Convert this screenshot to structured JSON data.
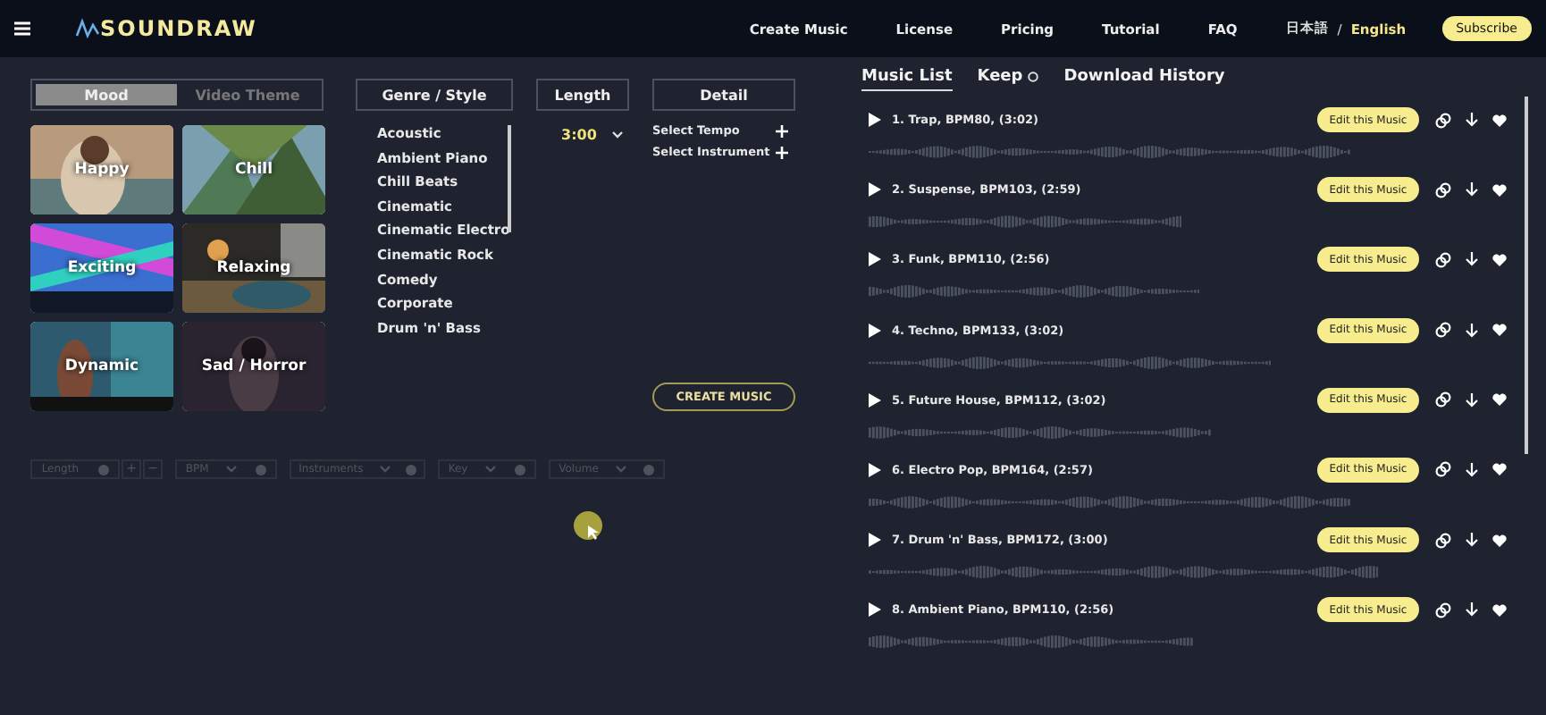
{
  "header": {
    "logo": "SOUNDRAW",
    "nav": [
      "Create Music",
      "License",
      "Pricing",
      "Tutorial",
      "FAQ"
    ],
    "languages": [
      {
        "label": "日本語",
        "selected": false
      },
      {
        "label": "English",
        "selected": true
      }
    ],
    "separator": "/",
    "subscribe": "Subscribe"
  },
  "mood_tabs": [
    {
      "label": "Mood",
      "selected": true
    },
    {
      "label": "Video Theme",
      "selected": false
    }
  ],
  "moods": [
    {
      "label": "Happy"
    },
    {
      "label": "Chill"
    },
    {
      "label": "Exciting"
    },
    {
      "label": "Relaxing"
    },
    {
      "label": "Dynamic"
    },
    {
      "label": "Sad / Horror"
    }
  ],
  "genre": {
    "title": "Genre / Style",
    "items": [
      "Acoustic",
      "Ambient Piano",
      "Chill Beats",
      "Cinematic",
      "Cinematic Electro",
      "Cinematic Rock",
      "Comedy",
      "Corporate",
      "Drum 'n' Bass"
    ]
  },
  "length": {
    "title": "Length",
    "value": "3:00"
  },
  "detail": {
    "title": "Detail",
    "items": [
      "Select Tempo",
      "Select Instrument"
    ]
  },
  "create_button": "CREATE MUSIC",
  "controls": [
    {
      "kind": "stepper",
      "label": "Length",
      "plus": "+",
      "minus": "−"
    },
    {
      "kind": "dropdown",
      "label": "BPM"
    },
    {
      "kind": "dropdown",
      "label": "Instruments"
    },
    {
      "kind": "dropdown",
      "label": "Key"
    },
    {
      "kind": "dropdown",
      "label": "Volume"
    }
  ],
  "list_tabs": [
    {
      "label": "Music List",
      "selected": true,
      "info": false
    },
    {
      "label": "Keep",
      "selected": false,
      "info": true
    },
    {
      "label": "Download History",
      "selected": false,
      "info": false
    }
  ],
  "tracks": [
    {
      "title": "1. Trap, BPM80, (3:02)",
      "edit": "Edit this Music"
    },
    {
      "title": "2. Suspense, BPM103, (2:59)",
      "edit": "Edit this Music"
    },
    {
      "title": "3. Funk, BPM110, (2:56)",
      "edit": "Edit this Music"
    },
    {
      "title": "4. Techno, BPM133, (3:02)",
      "edit": "Edit this Music"
    },
    {
      "title": "5. Future House, BPM112, (3:02)",
      "edit": "Edit this Music"
    },
    {
      "title": "6. Electro Pop, BPM164, (2:57)",
      "edit": "Edit this Music"
    },
    {
      "title": "7. Drum 'n' Bass, BPM172, (3:00)",
      "edit": "Edit this Music"
    },
    {
      "title": "8. Ambient Piano, BPM110, (2:56)",
      "edit": "Edit this Music"
    }
  ]
}
